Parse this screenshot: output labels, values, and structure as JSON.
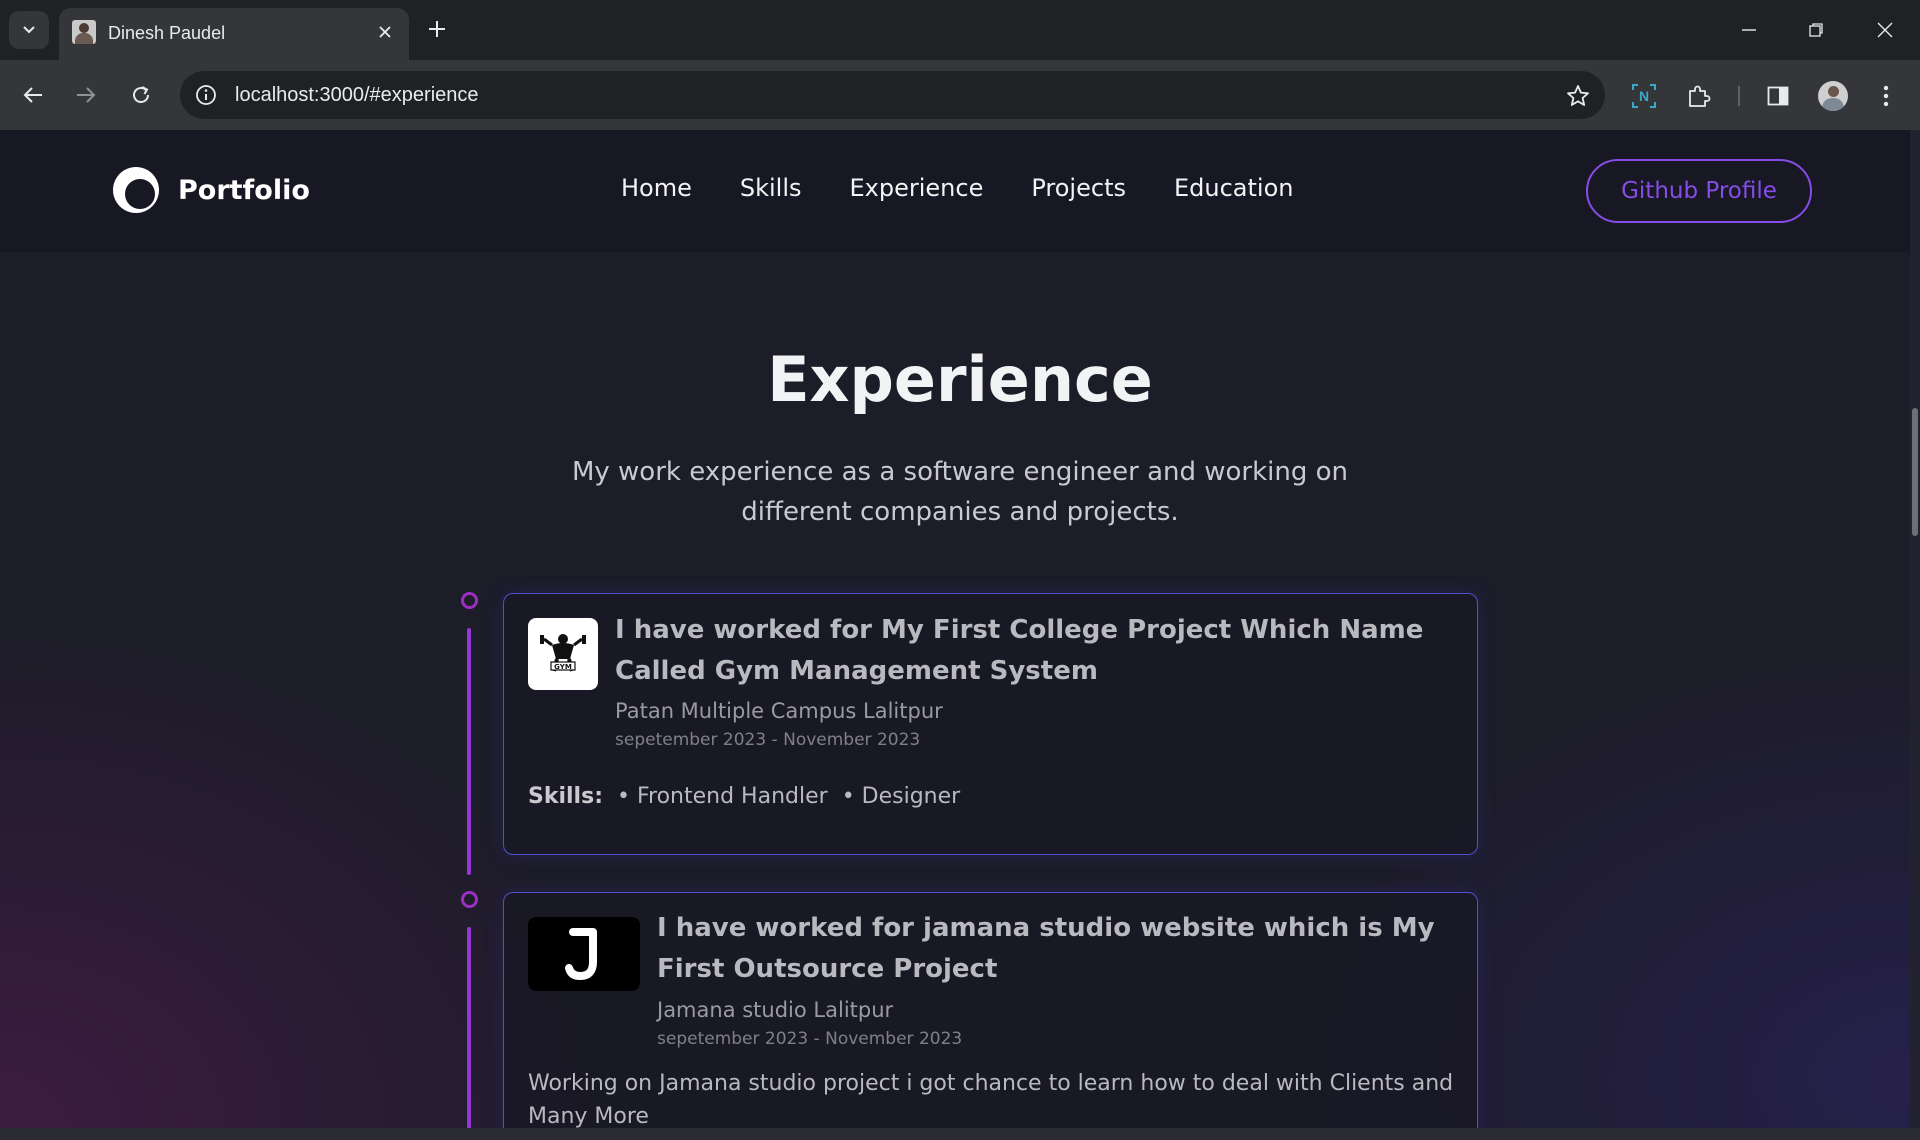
{
  "browser": {
    "tab_title": "Dinesh Paudel",
    "url": "localhost:3000/#experience"
  },
  "navbar": {
    "logo_text": "Portfolio",
    "links": [
      "Home",
      "Skills",
      "Experience",
      "Projects",
      "Education"
    ],
    "github_button": "Github Profile",
    "accent_color": "#854ce6"
  },
  "experience": {
    "title": "Experience",
    "description": "My work experience as a software engineer and working on different companies and projects.",
    "items": [
      {
        "logo": "gym-logo-icon",
        "role": "I have worked for My First College Project Which Name Called Gym Management System",
        "company": "Patan Multiple Campus Lalitpur",
        "date": "sepetember 2023 - November 2023",
        "skills_label": "Skills:",
        "skills": [
          "• Frontend Handler",
          "• Designer"
        ]
      },
      {
        "logo": "jamana-logo-icon",
        "role": "I have worked for jamana studio website which is My First Outsource Project",
        "company": "Jamana studio Lalitpur",
        "date": "sepetember 2023 - November 2023",
        "description": "Working on Jamana studio project i got chance to learn how to deal with Clients and Many More"
      }
    ]
  }
}
